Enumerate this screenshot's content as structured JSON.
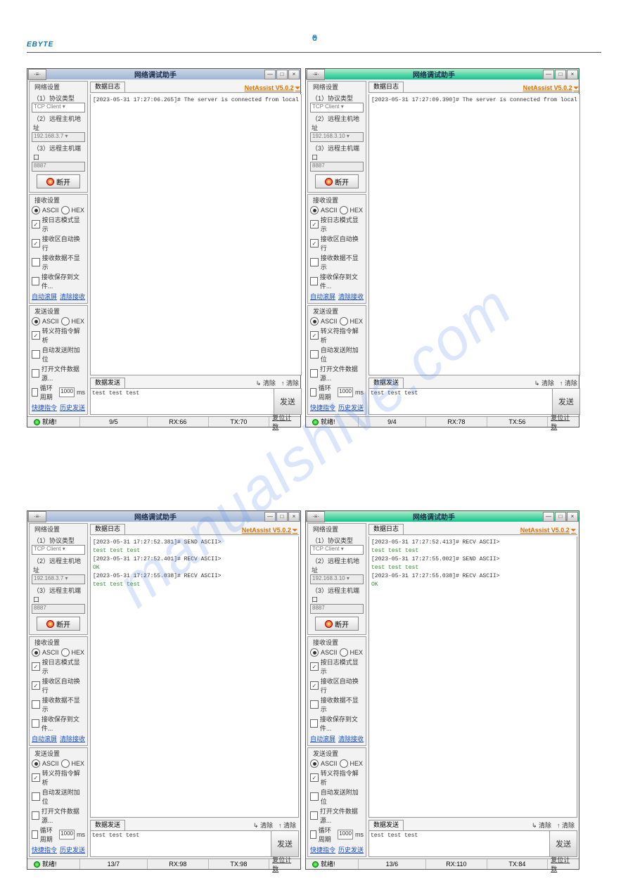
{
  "header": {
    "logo": "EBYTE"
  },
  "watermark": "manualshive.com",
  "common": {
    "app_title": "网络调试助手",
    "version": "NetAssist V5.0.2",
    "window_btns": [
      "—",
      "□",
      "×"
    ],
    "net_group": "网络设置",
    "proto_label": "（1）协议类型",
    "host_label": "（2）远程主机地址",
    "port_label": "（3）远程主机端口",
    "proto_value": "TCP Client",
    "port_value": "8887",
    "btn_disconnect": "断开",
    "recv_group": "接收设置",
    "send_group": "发送设置",
    "ascii": "ASCII",
    "hex": "HEX",
    "recv_opts": [
      "按日志模式显示",
      "接收区自动换行",
      "接收数据不显示",
      "接收保存到文件..."
    ],
    "recv_links": [
      "自动滚屏",
      "清除接收"
    ],
    "send_opts": [
      "转义符指令解析",
      "自动发送附加位",
      "打开文件数据源..."
    ],
    "loop_label": "循环周期",
    "loop_val": "1000",
    "loop_unit": "ms",
    "send_links": [
      "快捷指令",
      "历史发送"
    ],
    "data_log_tab": "数据日志",
    "data_send_tab": "数据发送",
    "clear_btn": "清除",
    "clear2_btn": "清除",
    "send_btn": "发送",
    "status_ready": "就绪!",
    "reset": "复位计数"
  },
  "panels": [
    {
      "host": "192.168.3.7",
      "title_green": false,
      "log": [
        {
          "t": "[2023-05-31 17:27:06.265]# The server is connected from local",
          "c": ""
        }
      ],
      "send_text": "test test test",
      "recv_checks": [
        true,
        true,
        false,
        false
      ],
      "send_checks": [
        true,
        false,
        false
      ],
      "loop_check": false,
      "status": {
        "mid": "9/5",
        "rx": "RX:66",
        "tx": "TX:70"
      }
    },
    {
      "host": "192.168.3.10",
      "title_green": true,
      "log": [
        {
          "t": "[2023-05-31 17:27:09.390]# The server is connected from local",
          "c": ""
        }
      ],
      "send_text": "test test test",
      "recv_checks": [
        true,
        true,
        false,
        false
      ],
      "send_checks": [
        true,
        false,
        false
      ],
      "loop_check": false,
      "status": {
        "mid": "9/4",
        "rx": "RX:78",
        "tx": "TX:56"
      }
    },
    {
      "host": "192.168.3.7",
      "title_green": false,
      "log": [
        {
          "t": "[2023-05-31 17:27:52.381]# SEND ASCII>",
          "c": ""
        },
        {
          "t": "test test test",
          "c": "grn"
        },
        {
          "t": "[2023-05-31 17:27:52.401]# RECV ASCII>",
          "c": ""
        },
        {
          "t": "OK",
          "c": "grn"
        },
        {
          "t": "[2023-05-31 17:27:55.038]# RECV ASCII>",
          "c": ""
        },
        {
          "t": "test test test",
          "c": "grn"
        }
      ],
      "send_text": "test test test",
      "recv_checks": [
        true,
        true,
        false,
        false
      ],
      "send_checks": [
        true,
        false,
        false
      ],
      "loop_check": false,
      "status": {
        "mid": "13/7",
        "rx": "RX:98",
        "tx": "TX:98"
      }
    },
    {
      "host": "192.168.3.10",
      "title_green": true,
      "log": [
        {
          "t": "[2023-05-31 17:27:52.413]# RECV ASCII>",
          "c": ""
        },
        {
          "t": "test test test",
          "c": "grn"
        },
        {
          "t": "[2023-05-31 17:27:55.002]# SEND ASCII>",
          "c": ""
        },
        {
          "t": "test test test",
          "c": "grn"
        },
        {
          "t": "[2023-05-31 17:27:55.038]# RECV ASCII>",
          "c": ""
        },
        {
          "t": "OK",
          "c": "grn"
        }
      ],
      "send_text": "test test test",
      "recv_checks": [
        true,
        true,
        false,
        false
      ],
      "send_checks": [
        true,
        false,
        false
      ],
      "loop_check": false,
      "status": {
        "mid": "13/6",
        "rx": "RX:110",
        "tx": "TX:84"
      }
    }
  ]
}
